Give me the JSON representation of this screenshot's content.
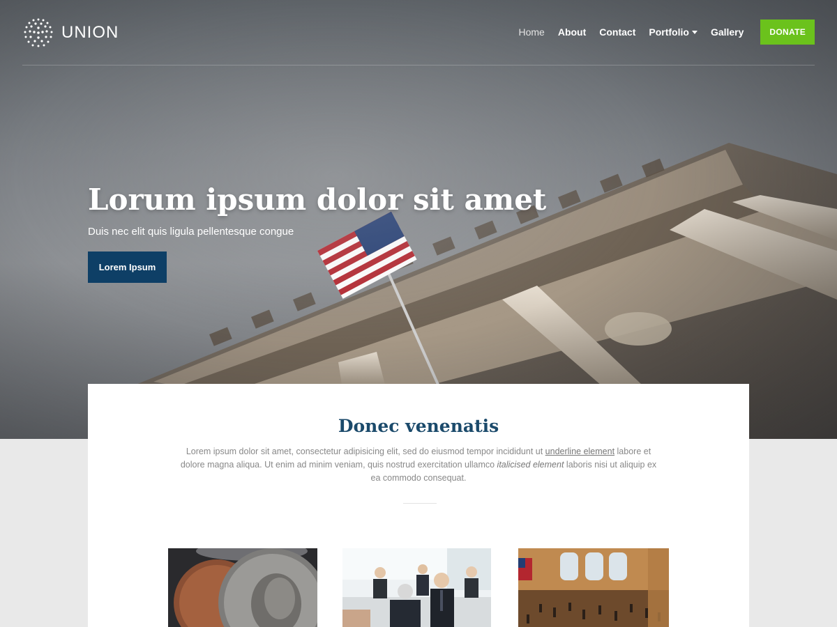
{
  "brand": {
    "name": "UNION",
    "logo_icon": "dotted-globe-icon"
  },
  "nav": {
    "items": [
      {
        "label": "Home",
        "active": true
      },
      {
        "label": "About"
      },
      {
        "label": "Contact"
      },
      {
        "label": "Portfolio",
        "dropdown": true
      },
      {
        "label": "Gallery"
      }
    ],
    "donate_label": "DONATE"
  },
  "hero": {
    "title": "Lorum ipsum dolor sit amet",
    "subtitle": "Duis nec elit quis ligula pellentesque congue",
    "button_label": "Lorem Ipsum",
    "image": "courthouse-columns-with-american-flag"
  },
  "section": {
    "title": "Donec venenatis",
    "text_1": "Lorem ipsum dolor sit amet, consectetur adipisicing elit, sed do eiusmod tempor incididunt ut ",
    "link_text": "underline element",
    "text_2": " labore et dolore magna aliqua. Ut enim ad minim veniam, quis nostrud exercitation ullamco ",
    "italic_text": "italicised element",
    "text_3": " laboris nisi ut aliquip ex ea commodo consequat."
  },
  "thumbnails": [
    {
      "image": "coins-closeup"
    },
    {
      "image": "business-meeting"
    },
    {
      "image": "grand-central-terminal"
    }
  ],
  "colors": {
    "donate": "#6bc21c",
    "hero_button": "#0e3f66",
    "section_title": "#1b4a6b"
  }
}
